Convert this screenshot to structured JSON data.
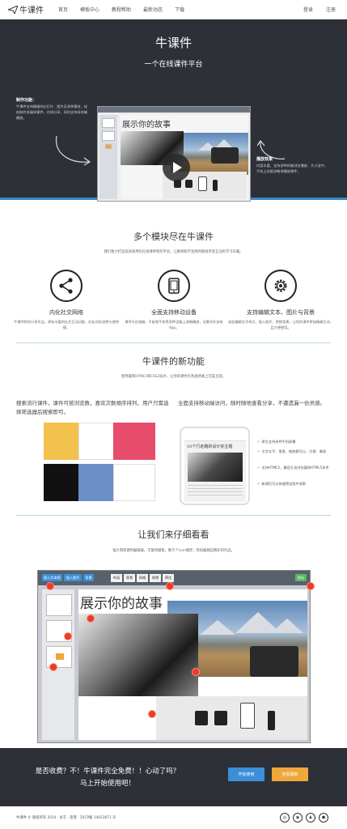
{
  "nav": {
    "brand": "牛课件",
    "links": [
      "首页",
      "模板中心",
      "教程帮助",
      "最新动态",
      "下载"
    ],
    "login": "登录",
    "register": "注册"
  },
  "hero": {
    "title": "牛课件",
    "subtitle": "一个在线课件平台",
    "left_heading": "制作功能：",
    "left_text": "牛课件支持精美的幻灯片、图片及多种素材，轻松制作多媒体课件，在线分享，同时支持多终端播放。",
    "right_heading": "播放效果",
    "right_text": "内容丰富，支持多种终端浏览播放，大小适中，手机上也能流畅地播放课件。",
    "story_title": "展示你的故事"
  },
  "modules": {
    "title": "多个模块尽在牛课件",
    "desc": "我们致力打造高效易用的在线课件制作平台，让教师和学生随时随地享受互动的学习乐趣。",
    "features": [
      {
        "icon": "share-icon",
        "title": "内化社交网络",
        "desc": "牛课件帮你分享作品，更有丰富的社交互动功能，好友间交流更方便快捷。"
      },
      {
        "icon": "tablet-icon",
        "title": "全面支持移动设备",
        "desc": "课件可在电脑、平板和手机等多种设备上流畅播放，无需另外安装App。"
      },
      {
        "icon": "gear-icon",
        "title": "支持编辑文本、图片与背景",
        "desc": "轻松编辑文字样式、插入图片，更换背景，让您的课件更加精美生动，且方便使用。"
      }
    ]
  },
  "new_features": {
    "title": "牛课件的新功能",
    "desc": "使用最新HTML5和CSS3技术，让你的课件在各类终端上完美呈现。",
    "left_text": "搜索流行课件，课件可按浏览数，喜欢次数顺序排列，用户只需选择筛选器后搜索即可。",
    "right_text": "全面支持移动端访问，随时随地查看分享，不遭遗漏一份灵感。",
    "tiles": [
      {
        "text": "",
        "color": "#f2c14e"
      },
      {
        "text": "",
        "color": "#ffffff"
      },
      {
        "text": "",
        "color": "#e84c6b"
      },
      {
        "text": "",
        "color": "#111111"
      },
      {
        "text": "",
        "color": "#6a8fc7"
      },
      {
        "text": "",
        "color": "#ffffff"
      }
    ],
    "phone_title": "10个行走路的设计好主题",
    "checklist": [
      "原生支持多种手机屏幕",
      "文字水平、垂直、缩放都可以，方便、美观",
      "支持HTML5，兼容主流浏览器和HTML5技术",
      "新建后可以快速预览图片效果"
    ]
  },
  "closer_look": {
    "title": "让我们来仔细看看",
    "desc": "强大而简便的编辑器，丰富的模板，数千个icon图库，轻松编辑出精彩的作品。",
    "toolbar_left": [
      "插入文本框",
      "插入图片",
      "背景"
    ],
    "tabs": [
      "布局",
      "背景",
      "网格",
      "效果",
      "预览"
    ],
    "save": "保存",
    "story_title": "展示你的故事"
  },
  "cta": {
    "line1": "是否收费？不！牛课件完全免费！！心动了吗？",
    "line2": "马上开始使用吧！",
    "primary": "开始使用",
    "secondary": "查看模板",
    "primary_color": "#3b8fd9",
    "secondary_color": "#f0a73a"
  },
  "footer": {
    "text": "牛课件 © 版权所有 2014 · 关于 · 反馈 · 京ICP备 14023871 号",
    "social": [
      "weibo-icon",
      "wechat-icon",
      "qq-icon",
      "renren-icon"
    ]
  }
}
